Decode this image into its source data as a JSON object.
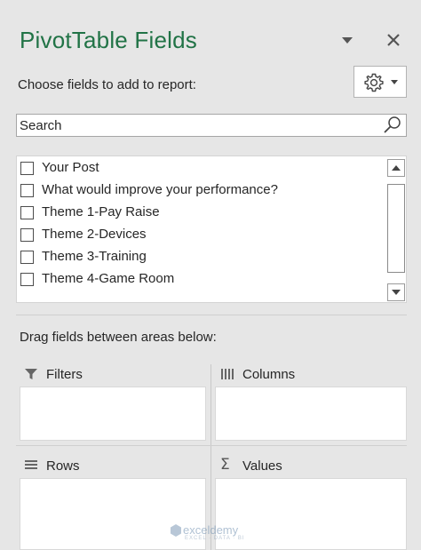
{
  "pane": {
    "title": "PivotTable Fields",
    "instructions": "Choose fields to add to report:"
  },
  "search": {
    "placeholder": "Search"
  },
  "fields": [
    {
      "label": "Your Post",
      "checked": false
    },
    {
      "label": "What would improve your performance?",
      "checked": false
    },
    {
      "label": "Theme 1-Pay Raise",
      "checked": false
    },
    {
      "label": "Theme 2-Devices",
      "checked": false
    },
    {
      "label": "Theme 3-Training",
      "checked": false
    },
    {
      "label": "Theme 4-Game Room",
      "checked": false
    }
  ],
  "areas": {
    "hint": "Drag fields between areas below:",
    "filters": "Filters",
    "columns": "Columns",
    "rows": "Rows",
    "values": "Values"
  },
  "watermark": {
    "name": "exceldemy",
    "tagline": "EXCEL · DATA · BI"
  },
  "colors": {
    "title": "#217346",
    "background": "#e6e6e6"
  }
}
